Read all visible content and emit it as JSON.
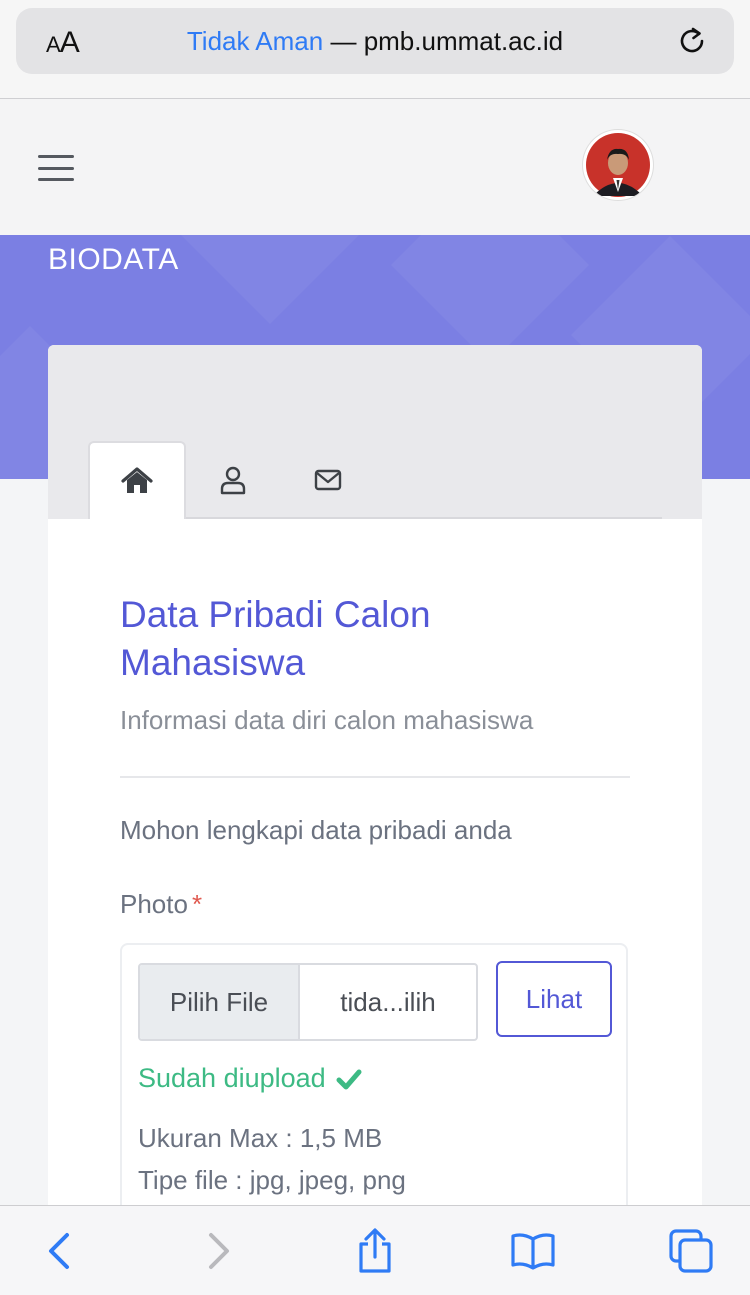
{
  "browser": {
    "text_size_label": "AA",
    "security_label": "Tidak Aman",
    "separator": "—",
    "domain": "pmb.ummat.ac.id"
  },
  "header": {
    "page_title": "BIODATA"
  },
  "tabs": [
    {
      "icon": "home-icon",
      "active": true
    },
    {
      "icon": "user-icon",
      "active": false
    },
    {
      "icon": "envelope-icon",
      "active": false
    }
  ],
  "content": {
    "title": "Data Pribadi Calon Mahasiswa",
    "subtitle": "Informasi data diri calon mahasiswa",
    "note": "Mohon lengkapi data pribadi anda",
    "photo_label": "Photo",
    "required_mark": "*",
    "file_button": "Pilih File",
    "file_name": "tida...ilih",
    "view_button": "Lihat",
    "upload_status": "Sudah diupload",
    "max_size": "Ukuran Max : 1,5 MB",
    "file_types": "Tipe file : jpg, jpeg, png"
  },
  "colors": {
    "accent": "#5358d6",
    "band": "#7b7fe3",
    "success": "#3dba84",
    "required": "#e0584e",
    "link": "#2f7bf5"
  }
}
